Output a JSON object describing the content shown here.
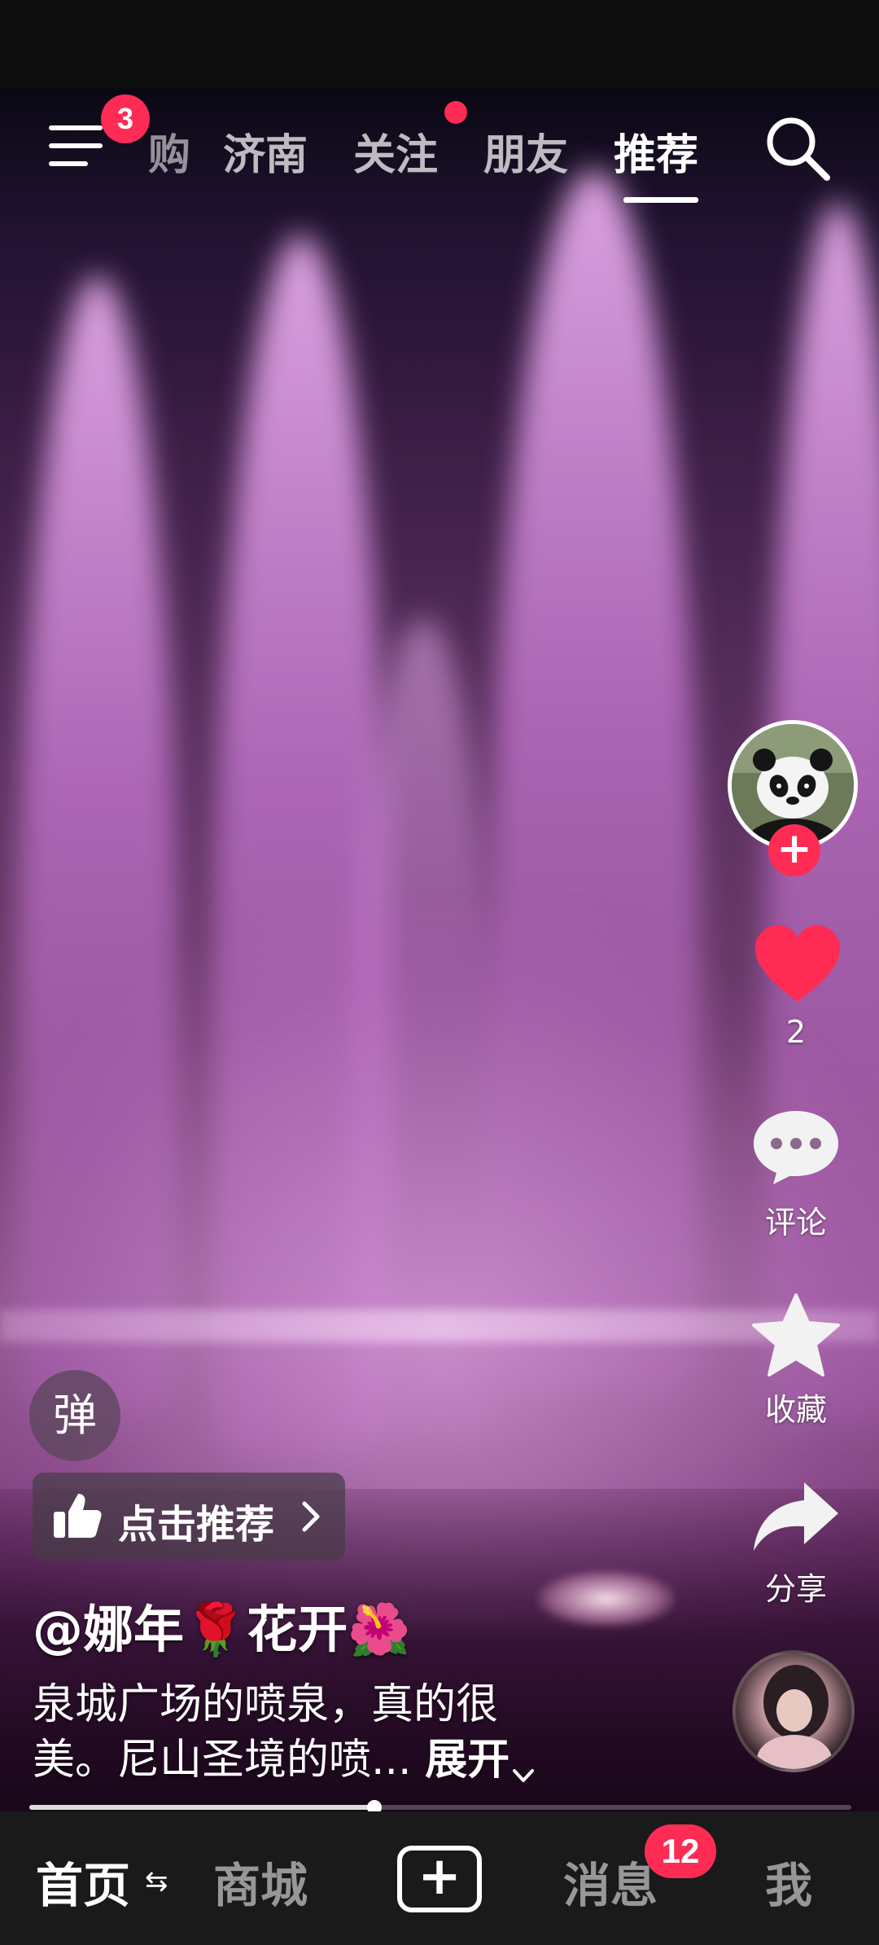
{
  "top_nav": {
    "menu_badge": "3",
    "tabs": [
      {
        "label": "购"
      },
      {
        "label": "济南"
      },
      {
        "label": "关注"
      },
      {
        "label": "朋友"
      },
      {
        "label": "推荐"
      }
    ],
    "active_tab": "推荐"
  },
  "rail": {
    "like_count": "2",
    "comment_label": "评论",
    "favorite_label": "收藏",
    "share_label": "分享"
  },
  "overlay": {
    "danmaku_label": "弹",
    "recommend_label": "点击推荐",
    "author": {
      "prefix": "@娜年",
      "emoji_1": "🌹",
      "middle": "花开",
      "emoji_2": "🌺"
    },
    "caption_line1": "泉城广场的喷泉，真的很",
    "caption_line2": "美。尼山圣境的喷...",
    "expand_label": "展开"
  },
  "progress": {
    "fraction": 0.42
  },
  "bottom_nav": {
    "home": "首页",
    "mall": "商城",
    "messages": "消息",
    "messages_badge": "12",
    "me": "我"
  },
  "colors": {
    "accent": "#fe2c55",
    "tabbar_bg": "#1a1a1a",
    "video_tint": "#c878c8"
  }
}
